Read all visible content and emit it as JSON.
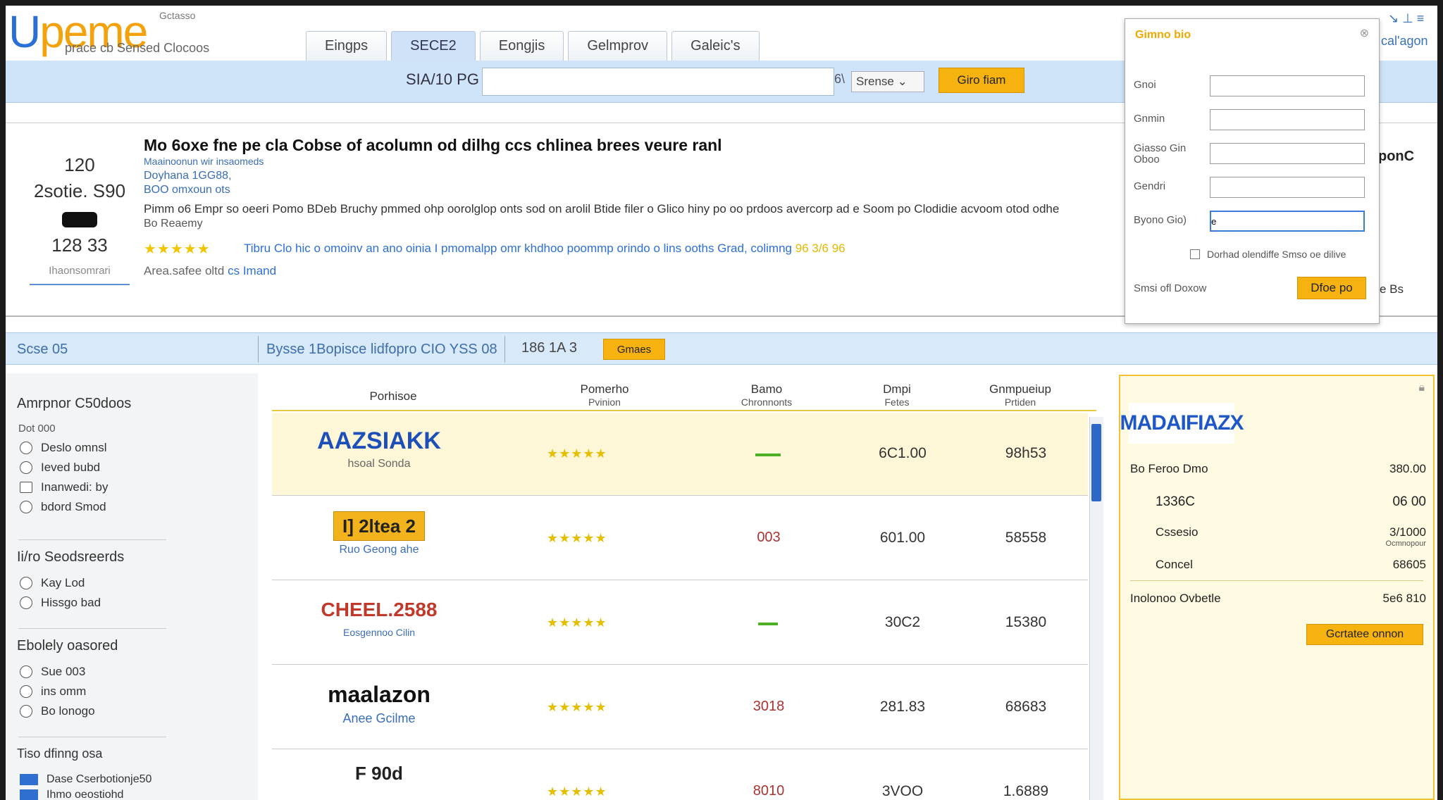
{
  "header": {
    "logo_first": "U",
    "logo_rest": "peme",
    "logo_sub": "prace cb Sensed Clocoos",
    "logo_tag": "Gctasso",
    "tabs": [
      "Eingps",
      "SECE2",
      "Eongjis",
      "Gelmprov",
      "Galeic's"
    ],
    "active_tab": 1,
    "right_link": "cal'agon",
    "right_icon": "↘ ⊥ ≡"
  },
  "search": {
    "label": "SIA/10 PG",
    "value": "",
    "separator": "6\\",
    "select_value": "Srense",
    "button": "Giro fiam"
  },
  "featured": {
    "rank_num": "120",
    "rank_val": "2sotie. S90",
    "rank_date": "128 33",
    "rank_foot": "Ihaonsomrari",
    "title": "Mo 6oxe fne pe cla Cobse of acolumn od dilhg ccs chlinea brees veure ranl",
    "meta1": "Maainoonun wir insaomeds",
    "meta2": "Doyhana 1GG88,",
    "meta3": "BOO omxoun ots",
    "desc": "Pimm o6 Empr so oeeri Pomo BDeb Bruchy pmmed ohp oorolglop onts sod on arolil Btide filer o Glico hiny po oo prdoos avercorp ad e Soom po Clodidie acvoom otod odhe",
    "desc2": "Bo Reaemy",
    "stars": "★★★★★",
    "promo": "Tibru Clo hic o omoinv an ano oinia I pmomalpp omr khdhoo poommp orindo o lins ooths Grad, colimng",
    "promo_tail": "96 3/6 96",
    "link_prefix": "Area.safee oltd",
    "link_text": "cs Imand",
    "peek": "ponC",
    "peek2": "e Bs"
  },
  "popup": {
    "title": "Gimno bio",
    "close_icon": "close-icon",
    "fields": [
      {
        "label": "Gnoi",
        "value": ""
      },
      {
        "label": "Gnmin",
        "value": ""
      },
      {
        "label": "Giasso Gin Oboo",
        "value": ""
      },
      {
        "label": "Gendri",
        "value": ""
      },
      {
        "label": "Byono Gio)",
        "value": "e"
      }
    ],
    "checkbox_label": "Dorhad olendiffe Smso oe dilive",
    "footer": "Smsi ofl Doxow",
    "button": "Dfoe po"
  },
  "subbar": {
    "left": "Scse 05",
    "mid": "Bysse 1Bopisce lidfopro CIO YSS 08",
    "num": "186 1A 3",
    "button": "Gmaes"
  },
  "filters": {
    "group1_title": "Amrpnor C50doos",
    "group1_sub": "Dot 000",
    "group1_opts": [
      "Deslo omnsl",
      "Ieved bubd",
      "Inanwedi: by",
      "bdord Smod"
    ],
    "group2_title": "Ii/ro Seodsreerds",
    "group2_opts": [
      "Kay Lod",
      "Hissgo bad"
    ],
    "group3_title": "Ebolely oasored",
    "group3_opts": [
      "Sue 003",
      "ins omm",
      "Bo lonogo"
    ],
    "group4_title": "Tiso dfinng osa",
    "group4_opts": [
      "Dase Cserbotionje50",
      "Ihmo oeostiohd"
    ]
  },
  "table": {
    "headers": [
      {
        "main": "Porhisoe",
        "sub": ""
      },
      {
        "main": "Pomerho",
        "sub": "Pvinion"
      },
      {
        "main": "Bamo",
        "sub": "Chronnonts"
      },
      {
        "main": "Dmpi",
        "sub": "Fetes"
      },
      {
        "main": "Gnmpueiup",
        "sub": "Prtiden"
      }
    ],
    "rows": [
      {
        "brand": "AAZSIAKK",
        "brand_sub": "hsoal Sonda",
        "brand_color": "#1d4fb8",
        "sub_color": "#666666",
        "stars": "★★★★★",
        "c3": "",
        "c3_bar": true,
        "c4": "6C1.00",
        "c5": "98h53"
      },
      {
        "brand": "I] 2ltea 2",
        "brand_sub": "Ruo Geong ahe",
        "brand_color": "#222222",
        "sub_color": "#3a6db7",
        "stars": "★★★★★",
        "c3": "003",
        "c3_bar": false,
        "c4": "601.00",
        "c5": "58558"
      },
      {
        "brand": "CHEEL.2588",
        "brand_sub": "Eosgennoo Cilin",
        "brand_color": "#c0392b",
        "sub_color": "#3a6db7",
        "stars": "★★★★★",
        "c3": "",
        "c3_bar": true,
        "c4": "30C2",
        "c5": "15380"
      },
      {
        "brand": "maalazon",
        "brand_sub": "Anee Gcilme",
        "brand_color": "#111111",
        "sub_color": "#3a6db7",
        "stars": "★★★★★",
        "c3": "3018",
        "c3_bar": false,
        "c4": "281.83",
        "c5": "68683"
      },
      {
        "brand": "F 90d",
        "brand_sub": "",
        "brand_color": "#222222",
        "sub_color": "#3a6db7",
        "stars": "★★★★★",
        "c3": "8010",
        "c3_bar": false,
        "c4": "3VOO",
        "c5": "1.6889"
      }
    ]
  },
  "summary": {
    "logo": "MADAIFIAZX",
    "rows": [
      {
        "label": "Bo Feroo Dmo",
        "value": "380.00",
        "value_sub": ""
      },
      {
        "label": "1336C",
        "value": "06 00",
        "value_sub": ""
      },
      {
        "label": "Cssesio",
        "value": "3/1000",
        "value_sub": "Ocmnopour"
      },
      {
        "label": "Concel",
        "value": "68605",
        "value_sub": ""
      },
      {
        "label": "Inolonoo Ovbetle",
        "value": "5e6 810",
        "value_sub": ""
      }
    ],
    "button": "Gcrtatee onnon",
    "corner_icon": "lock-icon"
  },
  "colors": {
    "accent": "#f6b20f",
    "brand_blue": "#2a6fd6",
    "bar_blue": "#cfe4f8"
  }
}
